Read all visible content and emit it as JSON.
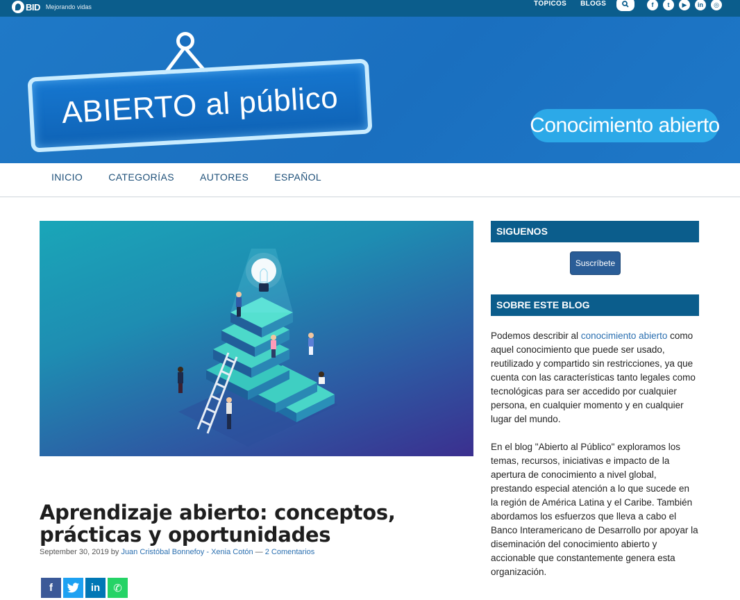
{
  "topbar": {
    "brand": "BID",
    "tagline": "Mejorando vidas",
    "links": [
      "TÓPICOS",
      "BLOGS"
    ],
    "social": [
      "f",
      "t",
      "▶",
      "in",
      "◎"
    ]
  },
  "banner": {
    "sign_bold": "ABIERTO",
    "sign_rest": " al público",
    "pill": "Conocimiento abierto"
  },
  "nav": {
    "items": [
      "INICIO",
      "CATEGORÍAS",
      "AUTORES",
      "ESPAÑOL"
    ]
  },
  "article": {
    "title": "Aprendizaje abierto: conceptos, prácticas y oportunidades",
    "date": "September 30, 2019",
    "by": "by",
    "authors": "Juan Cristóbal Bonnefoy - Xenia Cotón",
    "sep": " — ",
    "comments": "2 Comentarios",
    "share": [
      {
        "label": "f",
        "color": "#3b5998"
      },
      {
        "label": "🐦",
        "color": "#1da1f2"
      },
      {
        "label": "in",
        "color": "#0077b5"
      },
      {
        "label": "✆",
        "color": "#25d366"
      }
    ]
  },
  "sidebar": {
    "follow_heading": "SIGUENOS",
    "subscribe_label": "Suscríbete",
    "about_heading": "SOBRE ESTE BLOG",
    "about_p1_pre": "Podemos describir al ",
    "about_p1_link": "conocimiento abierto",
    "about_p1_post": " como aquel conocimiento que puede ser usado, reutilizado y compartido sin restricciones, ya que cuenta con las características tanto legales como tecnológicas para ser accedido por cualquier persona, en cualquier momento y en cualquier lugar del mundo.",
    "about_p2": "En el blog \"Abierto al Público\" exploramos los temas, recursos, iniciativas e impacto de la apertura de conocimiento a nivel global, prestando especial atención a lo que sucede en la región de América Latina y el Caribe. También abordamos los esfuerzos que lleva a cabo el Banco Interamericano de Desarrollo por apoyar la diseminación del conocimiento abierto y accionable que constantemente genera esta organización."
  },
  "colors": {
    "topbar": "#0b5d8c",
    "banner": "#1a6fbf",
    "pill": "#2ca9e8",
    "nav_text": "#1d4f78",
    "sidebar_heading": "#0b5d8c",
    "link": "#2a6fb0"
  }
}
